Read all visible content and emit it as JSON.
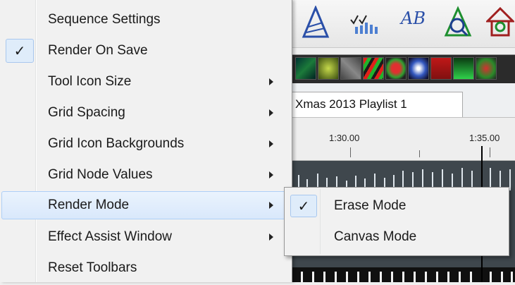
{
  "menu": {
    "items": [
      {
        "label": "Sequence Settings"
      },
      {
        "label": "Render On Save",
        "check": "✓"
      },
      {
        "label": "Tool Icon Size"
      },
      {
        "label": "Grid Spacing"
      },
      {
        "label": "Grid Icon Backgrounds"
      },
      {
        "label": "Grid Node Values"
      },
      {
        "label": "Render Mode"
      },
      {
        "label": "Effect Assist Window"
      },
      {
        "label": "Reset Toolbars"
      }
    ]
  },
  "submenu": {
    "items": [
      {
        "label": "Erase Mode",
        "check": "✓"
      },
      {
        "label": "Canvas Mode"
      }
    ]
  },
  "tabs": {
    "playlist": "Xmas 2013 Playlist 1"
  },
  "timeline": {
    "tick1": "1:30.00",
    "tick2": "1:35.00"
  },
  "toolbar": {
    "abc_text": "AB",
    "icons": [
      "triangle-icon",
      "checklist-bars-icon",
      "text-ab-icon",
      "magnify-triangle-icon",
      "house-icon"
    ]
  },
  "colors": {
    "hover_bg": "#d9e8fb",
    "hover_border": "#aecff7",
    "menu_bg": "#f1f1f1"
  }
}
